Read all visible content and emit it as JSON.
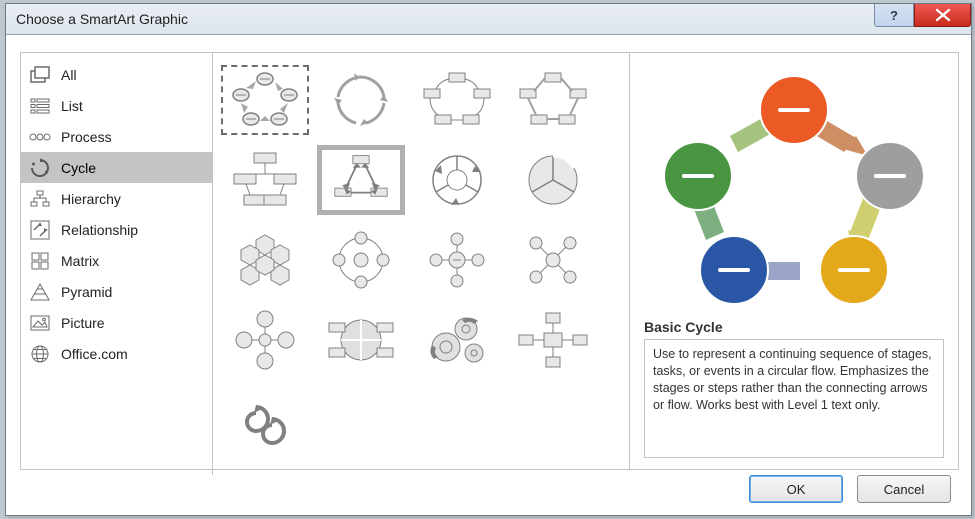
{
  "dialog": {
    "title": "Choose a SmartArt Graphic"
  },
  "sidebar": {
    "items": [
      {
        "label": "All"
      },
      {
        "label": "List"
      },
      {
        "label": "Process"
      },
      {
        "label": "Cycle"
      },
      {
        "label": "Hierarchy"
      },
      {
        "label": "Relationship"
      },
      {
        "label": "Matrix"
      },
      {
        "label": "Pyramid"
      },
      {
        "label": "Picture"
      },
      {
        "label": "Office.com"
      }
    ],
    "selected_index": 3
  },
  "gallery": {
    "selected_primary_index": 0,
    "selected_secondary_index": 5,
    "count": 17
  },
  "preview": {
    "title": "Basic Cycle",
    "description": "Use to represent a continuing sequence of stages, tasks, or events in a circular flow. Emphasizes the stages or steps rather than the connecting arrows or flow. Works best with Level 1 text only.",
    "node_colors": [
      "#eb5a24",
      "#9e9e9e",
      "#e4a81b",
      "#2a57a5",
      "#4a9541"
    ]
  },
  "footer": {
    "ok_label": "OK",
    "cancel_label": "Cancel"
  }
}
